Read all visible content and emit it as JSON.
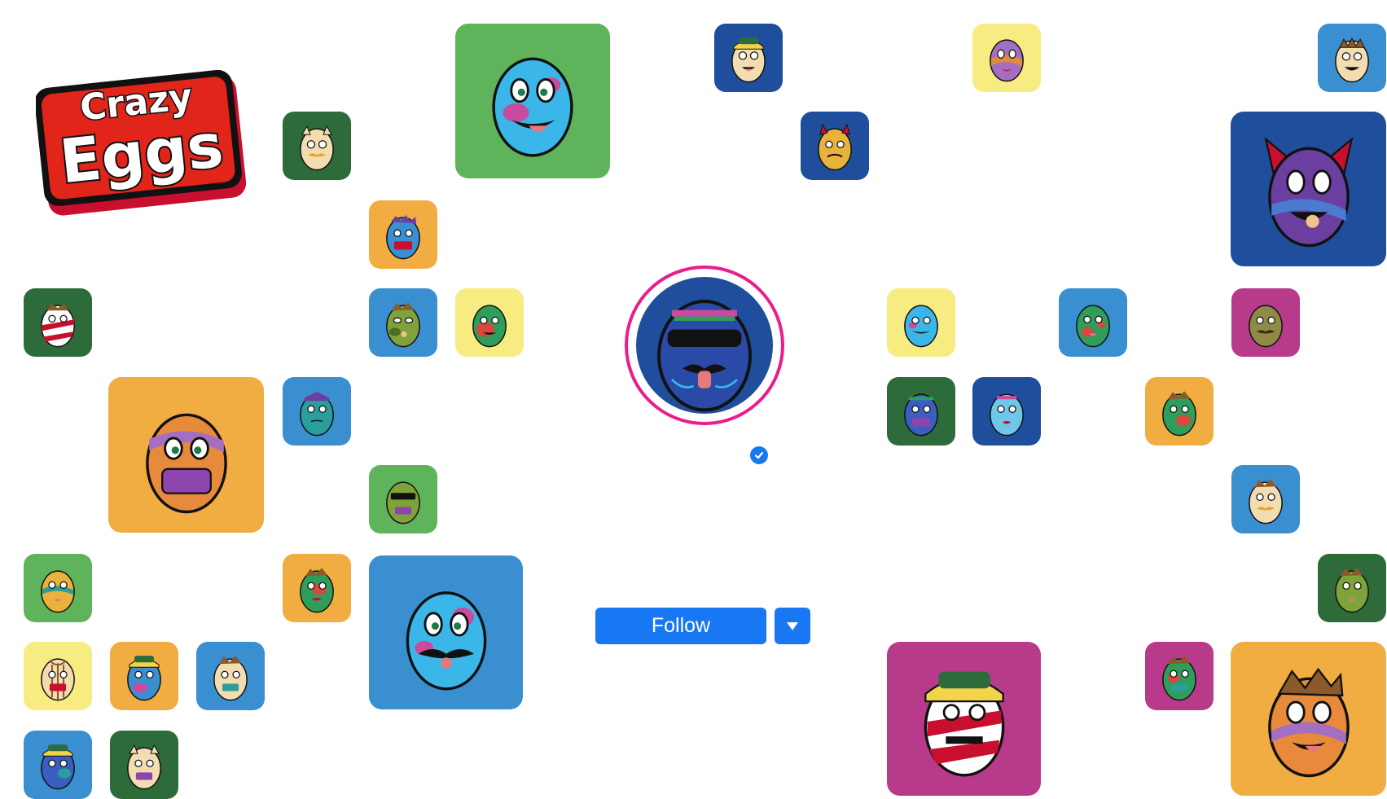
{
  "brand": {
    "logo_line1": "Crazy",
    "logo_line2": "Eggs"
  },
  "profile": {
    "verified_icon": "verified-check-icon",
    "ring_color": "#e91e8c"
  },
  "actions": {
    "follow_label": "Follow",
    "dropdown_icon": "caret-down-icon",
    "button_color": "#1877f2"
  },
  "palette": {
    "green": "#5fb35a",
    "dark_green": "#2e6b3a",
    "navy": "#1f4f9c",
    "blue": "#3a8fd0",
    "yellow": "#f6ec82",
    "orange": "#f2ad42",
    "magenta": "#b83a8a"
  }
}
